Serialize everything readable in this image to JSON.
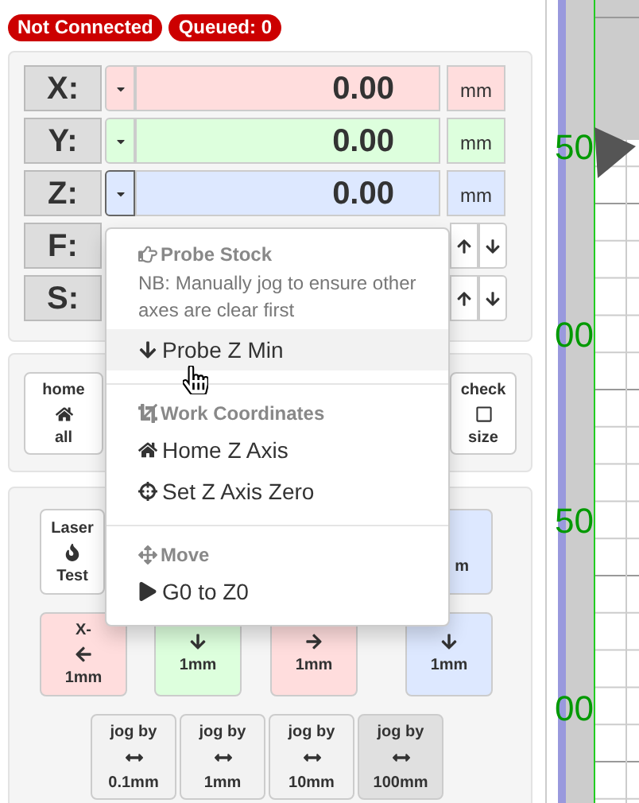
{
  "status_badges": [
    "Not Connected",
    "Queued: 0"
  ],
  "axes": [
    {
      "label": "X:",
      "value": "0.00",
      "unit": "mm",
      "color": "#ffdddd"
    },
    {
      "label": "Y:",
      "value": "0.00",
      "unit": "mm",
      "color": "#ddffdd"
    },
    {
      "label": "Z:",
      "value": "0.00",
      "unit": "mm",
      "color": "#dde8ff"
    }
  ],
  "rate_rows": [
    {
      "label": "F:"
    },
    {
      "label": "S:"
    }
  ],
  "dropdown": [
    {
      "kind": "header",
      "text": "Probe Stock"
    },
    {
      "kind": "note",
      "text": "NB: Manually jog to ensure other axes are clear first"
    },
    {
      "kind": "item",
      "text": "Probe Z Min",
      "selected": true
    },
    {
      "kind": "divider"
    },
    {
      "kind": "header",
      "text": "Work Coordinates"
    },
    {
      "kind": "item",
      "text": "Home Z Axis",
      "selected": false
    },
    {
      "kind": "item",
      "text": "Set Z Axis Zero",
      "selected": false
    },
    {
      "kind": "divider"
    },
    {
      "kind": "header",
      "text": "Move"
    },
    {
      "kind": "item",
      "text": "G0 to Z0",
      "selected": false
    }
  ],
  "home_buttons": [
    {
      "top": "home",
      "bottom": "all"
    },
    {
      "top": "check",
      "bottom": "size"
    }
  ],
  "jog_rows": [
    [
      {
        "top": "Laser",
        "bottom": "Test",
        "color": "#ffffff"
      },
      {
        "bottom": "m",
        "color": "#dde8ff"
      }
    ],
    [
      {
        "top": "X-",
        "bottom": "1mm",
        "color": "#ffdddd"
      },
      {
        "bottom": "1mm",
        "color": "#ddffdd"
      },
      {
        "bottom": "1mm",
        "color": "#ffdddd"
      },
      {
        "bottom": "1mm",
        "color": "#dde8ff"
      }
    ]
  ],
  "jog_steps": [
    {
      "top": "jog by",
      "bottom": "0.1mm",
      "selected": false
    },
    {
      "top": "jog by",
      "bottom": "1mm",
      "selected": false
    },
    {
      "top": "jog by",
      "bottom": "10mm",
      "selected": false
    },
    {
      "top": "jog by",
      "bottom": "100mm",
      "selected": true
    }
  ],
  "canvas": {
    "labels": [
      "50",
      "00",
      "50",
      "00"
    ]
  }
}
